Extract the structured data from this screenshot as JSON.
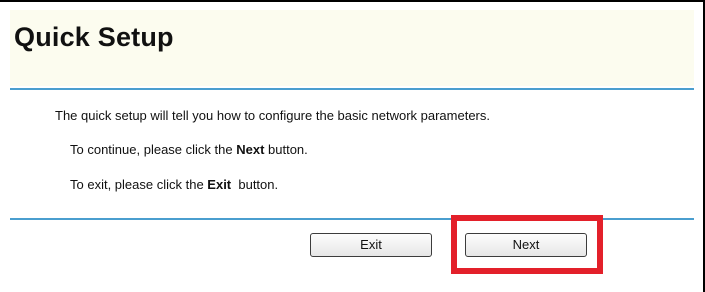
{
  "title": "Quick Setup",
  "description": "The quick setup will tell you how to configure the basic network parameters.",
  "continue_line": {
    "prefix": "To continue, please click the ",
    "keyword": "Next",
    "suffix": " button."
  },
  "exit_line": {
    "prefix": "To exit, please click the ",
    "keyword": "Exit",
    "suffix": "  button."
  },
  "buttons": {
    "exit_label": "Exit",
    "next_label": "Next"
  },
  "colors": {
    "accent_rule": "#4a9ecf",
    "header_background": "#fcfcef",
    "highlight_box": "#e3202a"
  }
}
